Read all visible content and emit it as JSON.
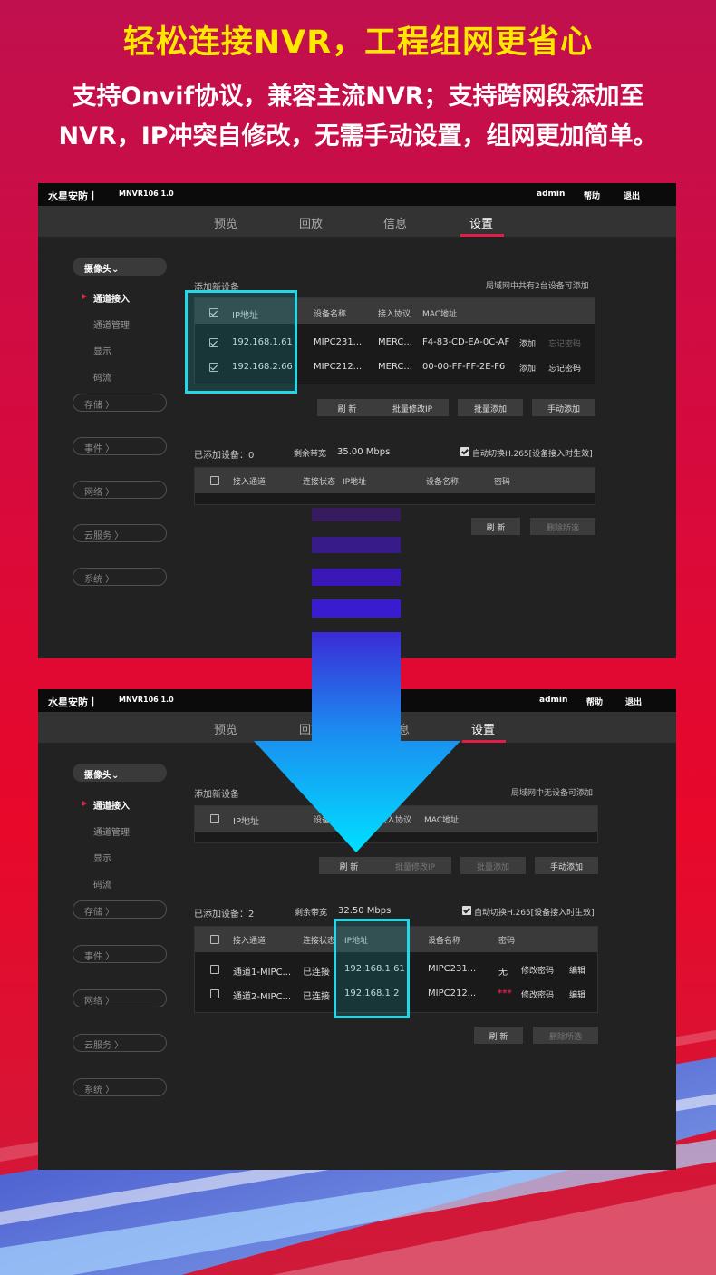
{
  "headline": "轻松连接NVR，工程组网更省心",
  "subline1": "支持Onvif协议，兼容主流NVR；支持跨网段添加至",
  "subline2": "NVR，IP冲突自修改，无需手动设置，组网更加简单。",
  "colors": {
    "headline": "#ffe800",
    "highlight": "#27d6e6",
    "accent": "#e11d48",
    "arrow": "#08c8f5"
  },
  "p1": {
    "brand": "水星安防丨",
    "model": "MNVR106 1.0",
    "user": "admin",
    "help": "帮助",
    "logout": "退出",
    "tabs": [
      "预览",
      "回放",
      "信息",
      "设置"
    ],
    "side_camera": "摄像头⌄",
    "side_items": [
      "通道接入",
      "通道管理",
      "显示",
      "码流"
    ],
    "side_storage": "存储 〉",
    "side_event": "事件 〉",
    "side_network": "网络 〉",
    "side_cloud": "云服务 〉",
    "side_system": "系统 〉",
    "add_title": "添加新设备",
    "lan_note": "局域网中共有2台设备可添加",
    "headers": {
      "ip": "IP地址",
      "name": "设备名称",
      "proto": "接入协议",
      "mac": "MAC地址"
    },
    "rows": [
      {
        "ip": "192.168.1.61",
        "name": "MIPC231...",
        "proto": "MERC...",
        "mac": "F4-83-CD-EA-0C-AF",
        "add": "添加",
        "pwd": "忘记密码"
      },
      {
        "ip": "192.168.2.66",
        "name": "MIPC212...",
        "proto": "MERC...",
        "mac": "00-00-FF-FF-2E-F6",
        "add": "添加",
        "pwd": "忘记密码"
      }
    ],
    "btn_refresh": "刷 新",
    "btn_batch_ip": "批量修改IP",
    "btn_batch_add": "批量添加",
    "btn_manual": "手动添加",
    "added_label": "已添加设备：0",
    "bw_label": "剩余带宽",
    "bw_value": "35.00 Mbps",
    "auto_switch": "自动切换H.265[设备接入时生效]",
    "h2": {
      "channel": "接入通道",
      "status": "连接状态",
      "ip": "IP地址",
      "name": "设备名称",
      "pwd": "密码"
    },
    "btn_refresh2": "刷 新",
    "btn_delete": "删除所选"
  },
  "p2": {
    "brand": "水星安防丨",
    "model": "MNVR106 1.0",
    "user": "admin",
    "help": "帮助",
    "logout": "退出",
    "tabs": [
      "预览",
      "回放",
      "信息",
      "设置"
    ],
    "side_camera": "摄像头⌄",
    "side_items": [
      "通道接入",
      "通道管理",
      "显示",
      "码流"
    ],
    "side_storage": "存储 〉",
    "side_event": "事件 〉",
    "side_network": "网络 〉",
    "side_cloud": "云服务 〉",
    "side_system": "系统 〉",
    "add_title": "添加新设备",
    "lan_note": "局域网中无设备可添加",
    "headers": {
      "ip": "IP地址",
      "name": "设备名称",
      "proto": "接入协议",
      "mac": "MAC地址"
    },
    "btn_refresh": "刷 新",
    "btn_batch_ip": "批量修改IP",
    "btn_batch_add": "批量添加",
    "btn_manual": "手动添加",
    "added_label": "已添加设备：2",
    "bw_label": "剩余带宽",
    "bw_value": "32.50 Mbps",
    "auto_switch": "自动切换H.265[设备接入时生效]",
    "h2": {
      "channel": "接入通道",
      "status": "连接状态",
      "ip": "IP地址",
      "name": "设备名称",
      "pwd": "密码"
    },
    "rows": [
      {
        "channel": "通道1-MIPC...",
        "status": "已连接",
        "ip": "192.168.1.61",
        "name": "MIPC231...",
        "pwd": "无",
        "edit_pwd": "修改密码",
        "edit": "编辑"
      },
      {
        "channel": "通道2-MIPC...",
        "status": "已连接",
        "ip": "192.168.1.2",
        "name": "MIPC212...",
        "pwd": "***",
        "edit_pwd": "修改密码",
        "edit": "编辑"
      }
    ],
    "btn_refresh2": "刷 新",
    "btn_delete": "删除所选"
  }
}
